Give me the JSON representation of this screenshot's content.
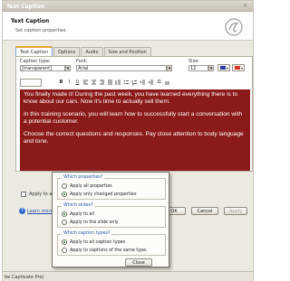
{
  "window": {
    "title": "Text Caption",
    "close_glyph": "✕"
  },
  "header": {
    "title": "Text Caption",
    "subtitle": "Set caption properties.",
    "logo_icon": "adobe-captivate-logo"
  },
  "tabs": [
    {
      "label": "Text Caption",
      "active": true
    },
    {
      "label": "Options",
      "active": false
    },
    {
      "label": "Audio",
      "active": false
    },
    {
      "label": "Size and Position",
      "active": false
    }
  ],
  "caption_type": {
    "label": "Caption type:",
    "value": "[transparent]"
  },
  "font": {
    "label": "Font:",
    "value": "Arial"
  },
  "size": {
    "label": "Size:",
    "value": "12"
  },
  "format": {
    "bold": "B",
    "italic": "I",
    "underline": "U",
    "special_char": "Ω"
  },
  "colors": {
    "text_color": "#000000",
    "highlight": "#ffffff",
    "caption_bg": "#8b1a1a",
    "caption_text": "#ffffff"
  },
  "caption_text": [
    "You finally made it! During the past week, you have learned everything there is to know about our cars. Now it's time to actually sell them.",
    "In this training scenario, you will learn how to successfully start a conversation with a potential customer.",
    "Choose the correct questions and responses. Pay close attention to body language and tone."
  ],
  "apply_to_all": {
    "label": "Apply to all"
  },
  "learn_more": {
    "label": "Learn more..."
  },
  "buttons": {
    "ok": "OK",
    "cancel": "Cancel",
    "apply": "Apply"
  },
  "status": {
    "text": "be Captivate Proj"
  },
  "popup": {
    "group1": {
      "title": "Which properties?",
      "options": [
        {
          "label": "Apply all properties",
          "selected": false
        },
        {
          "label": "Apply only changed properties",
          "selected": true
        }
      ]
    },
    "group2": {
      "title": "Which slides?",
      "options": [
        {
          "label": "Apply to all",
          "selected": true
        },
        {
          "label": "Apply to the slide only",
          "selected": false
        }
      ]
    },
    "group3": {
      "title": "Which caption types?",
      "options": [
        {
          "label": "Apply to all caption types",
          "selected": true
        },
        {
          "label": "Apply to captions of the same type.",
          "selected": false
        }
      ]
    },
    "close_label": "Close"
  }
}
